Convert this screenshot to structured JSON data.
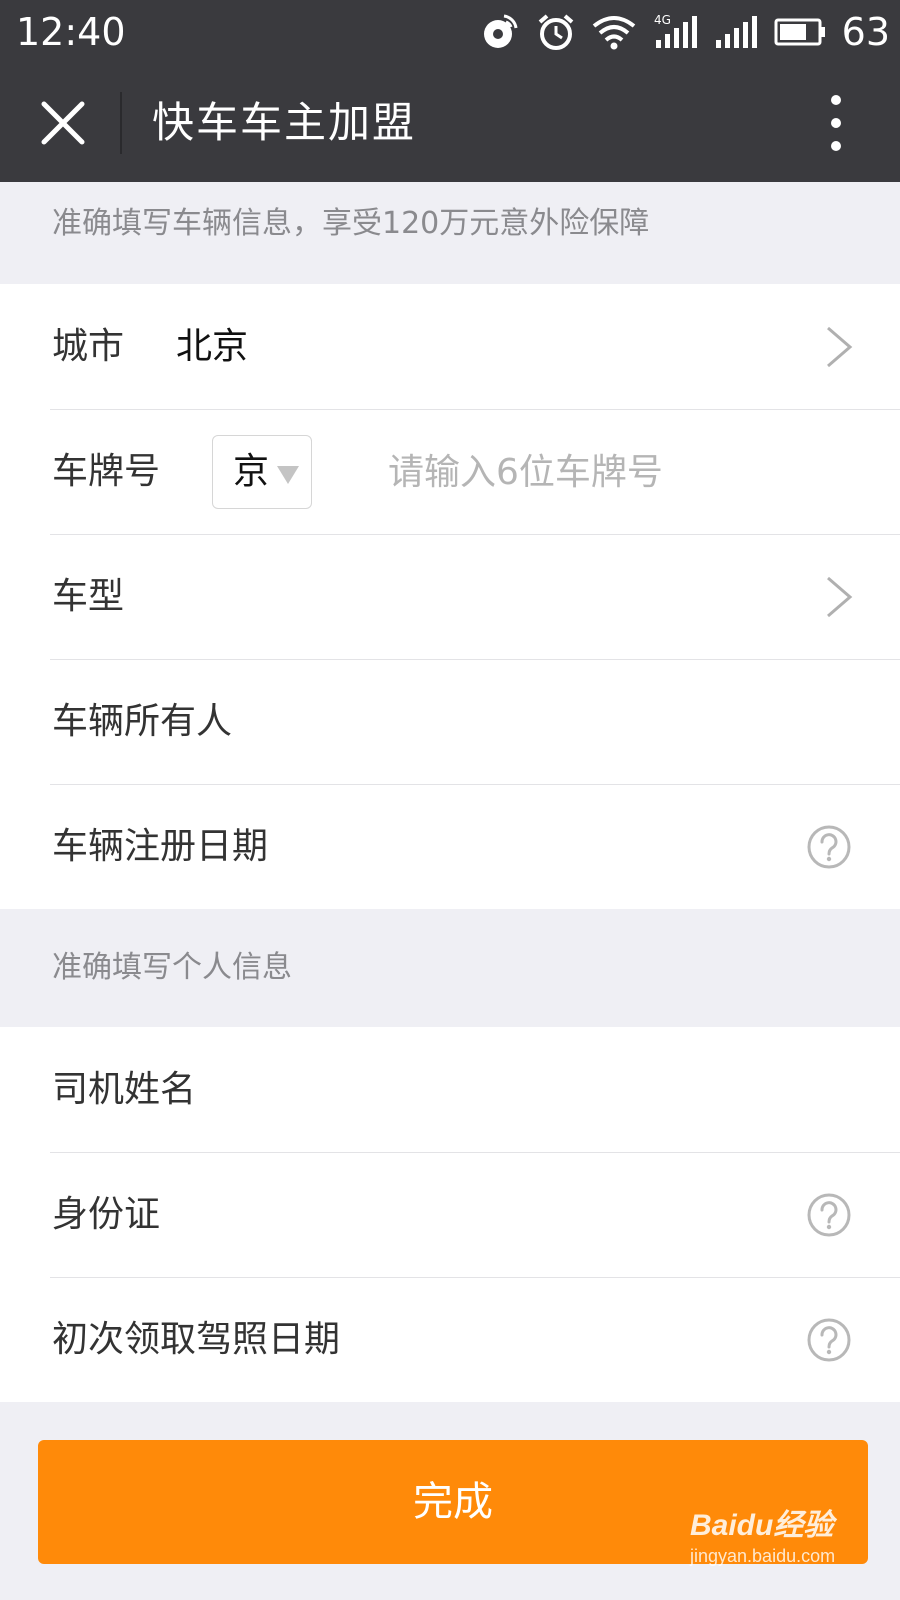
{
  "status_bar": {
    "time": "12:40",
    "network": "4G",
    "battery": "63",
    "icons": [
      "location-icon",
      "alarm-icon",
      "wifi-icon",
      "signal-4g-icon",
      "signal-icon",
      "battery-icon"
    ]
  },
  "header": {
    "title": "快车车主加盟",
    "close_icon": "close-icon",
    "more_icon": "more-vertical-icon"
  },
  "vehicle_section": {
    "hint": "准确填写车辆信息，享受120万元意外险保障",
    "city": {
      "label": "城市",
      "value": "北京"
    },
    "plate": {
      "label": "车牌号",
      "province": "京",
      "placeholder": "请输入6位车牌号",
      "value": ""
    },
    "model": {
      "label": "车型"
    },
    "owner": {
      "label": "车辆所有人"
    },
    "register_date": {
      "label": "车辆注册日期"
    }
  },
  "personal_section": {
    "hint": "准确填写个人信息",
    "driver_name": {
      "label": "司机姓名"
    },
    "id_card": {
      "label": "身份证"
    },
    "license_date": {
      "label": "初次领取驾照日期"
    }
  },
  "submit": {
    "label": "完成"
  },
  "watermark": {
    "brand": "Baidu经验",
    "url": "jingyan.baidu.com"
  },
  "colors": {
    "header_bg": "#3a3a3e",
    "page_bg": "#efeff4",
    "accent": "#ff8a09",
    "hint_text": "#8a8a8e",
    "placeholder": "#b5b5b5"
  }
}
